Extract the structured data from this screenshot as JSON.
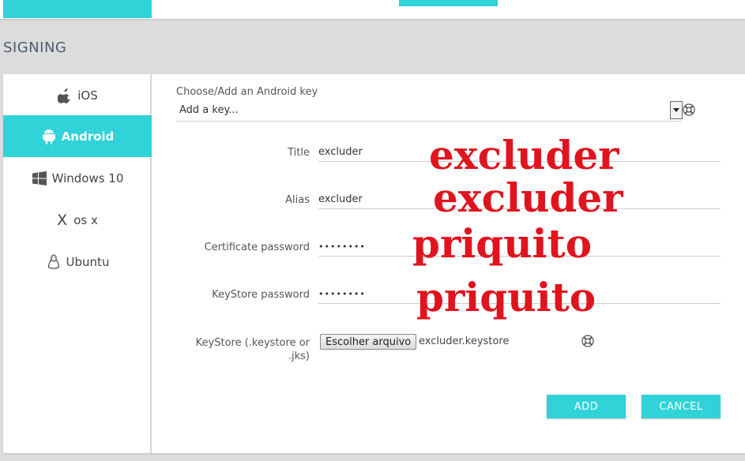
{
  "section_title": "SIGNING",
  "sidebar": {
    "items": [
      {
        "label": "iOS",
        "icon": "apple-icon"
      },
      {
        "label": "Android",
        "icon": "android-icon",
        "active": true
      },
      {
        "label": "Windows 10",
        "icon": "windows-icon"
      },
      {
        "label": "os x",
        "icon": "x-mark",
        "prefix": "X"
      },
      {
        "label": "Ubuntu",
        "icon": "linux-icon"
      }
    ]
  },
  "form": {
    "key_label": "Choose/Add an Android key",
    "key_select_value": "Add a key...",
    "title_label": "Title",
    "title_value": "excluder",
    "alias_label": "Alias",
    "alias_value": "excluder",
    "cert_password_label": "Certificate password",
    "cert_password_value": "••••••••",
    "keystore_password_label": "KeyStore password",
    "keystore_password_value": "••••••••",
    "keystore_label": "KeyStore (.keystore or .jks)",
    "file_button_label": "Escolher arquivo",
    "file_name": "excluder.keystore"
  },
  "buttons": {
    "add": "ADD",
    "cancel": "CANCEL"
  },
  "annotations": [
    "excluder",
    "excluder",
    "priquito",
    "priquito"
  ],
  "colors": {
    "accent": "#2fd3d8",
    "annotation": "#e0141e",
    "background": "#dcdcdc"
  }
}
